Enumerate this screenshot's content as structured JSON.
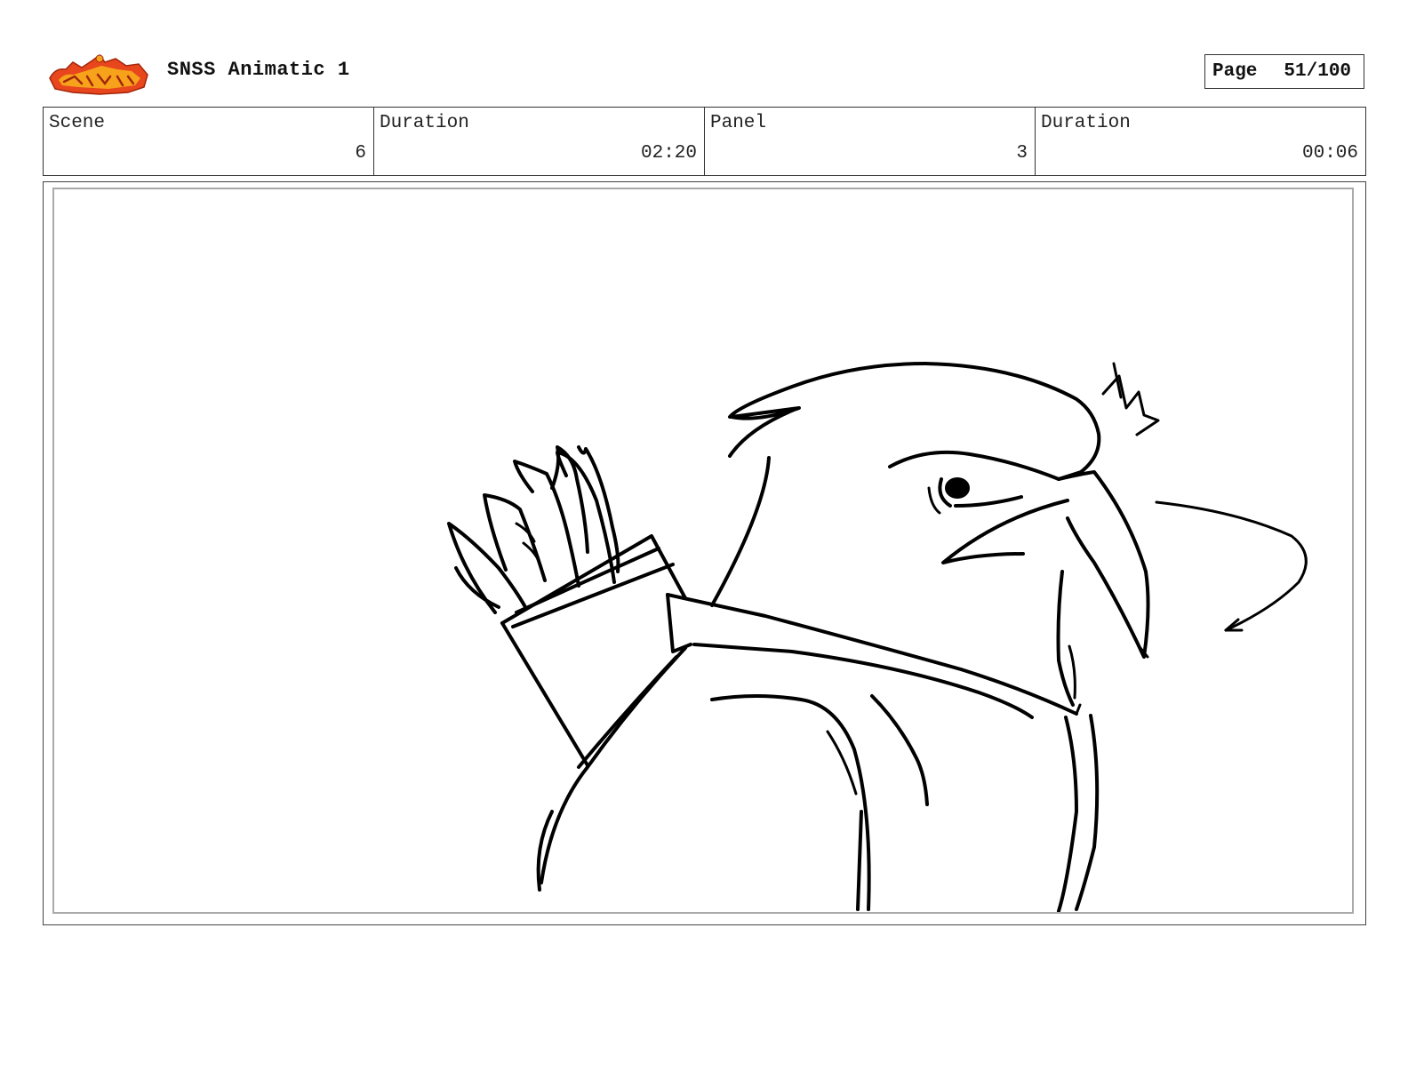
{
  "header": {
    "project_title": "SNSS Animatic 1",
    "page_label": "Page",
    "page_number": "51/100"
  },
  "info": {
    "scene_label": "Scene",
    "scene_value": "6",
    "scene_duration_label": "Duration",
    "scene_duration_value": "02:20",
    "panel_label": "Panel",
    "panel_value": "3",
    "panel_duration_label": "Duration",
    "panel_duration_value": "00:06"
  },
  "colors": {
    "logo_primary": "#e8461c",
    "logo_secondary": "#f7a21b",
    "ink": "#000000"
  },
  "icons": {
    "logo": "show-logo-icon"
  }
}
